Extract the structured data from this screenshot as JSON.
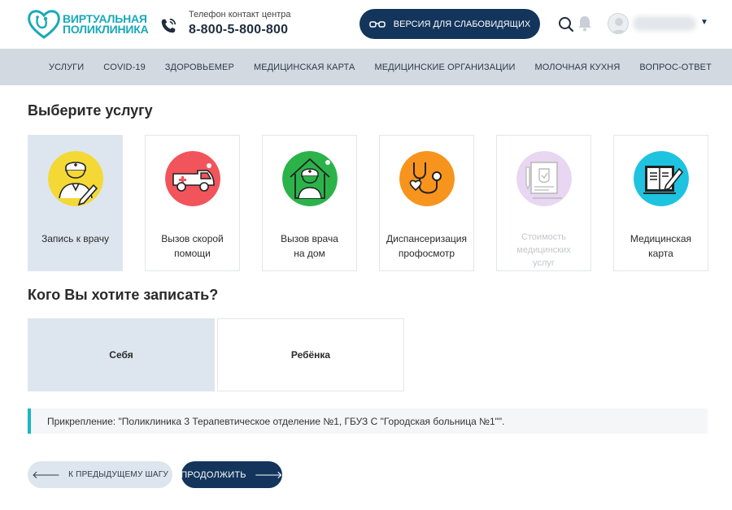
{
  "header": {
    "logo_line1": "ВИРТУАЛЬНАЯ",
    "logo_line2": "ПОЛИКЛИНИКА",
    "phone_caption": "Телефон контакт центра",
    "phone_number": "8-800-5-800-800",
    "low_vision_label": "ВЕРСИЯ ДЛЯ СЛАБОВИДЯЩИХ",
    "brand_color": "#1aa9b8",
    "dark_color": "#13355c"
  },
  "nav": {
    "items": [
      "УСЛУГИ",
      "COVID-19",
      "ЗДОРОВЬЕМЕР",
      "МЕДИЦИНСКАЯ КАРТА",
      "МЕДИЦИНСКИЕ ОРГАНИЗАЦИИ",
      "МОЛОЧНАЯ КУХНЯ",
      "ВОПРОС-ОТВЕТ"
    ]
  },
  "service_section": {
    "title": "Выберите услугу",
    "cards": [
      {
        "line1": "Запись к врачу",
        "line2": "",
        "line3": "",
        "icon": "doctor-writing-icon",
        "color": "#f4d836",
        "state": "active"
      },
      {
        "line1": "Вызов скорой",
        "line2": "помощи",
        "line3": "",
        "icon": "ambulance-icon",
        "color": "#f2545b",
        "state": "normal"
      },
      {
        "line1": "Вызов врача",
        "line2": "на дом",
        "line3": "",
        "icon": "home-doctor-icon",
        "color": "#2bb34a",
        "state": "normal"
      },
      {
        "line1": "Диспансеризация",
        "line2": "профосмотр",
        "line3": "",
        "icon": "stethoscope-icon",
        "color": "#f7941d",
        "state": "normal"
      },
      {
        "line1": "Стоимость",
        "line2": "медицинских",
        "line3": "услуг",
        "icon": "price-document-icon",
        "color": "#b57bd6",
        "state": "disabled"
      },
      {
        "line1": "Медицинская",
        "line2": "карта",
        "line3": "",
        "icon": "medical-book-icon",
        "color": "#1ec3e0",
        "state": "normal"
      }
    ]
  },
  "whom_section": {
    "title": "Кого Вы хотите записать?",
    "self_label": "Себя",
    "child_label": "Ребёнка"
  },
  "attachment_text": "Прикрепление: \"Поликлиника 3 Терапевтическое отделение №1, ГБУЗ С \"Городская больница №1\"\".",
  "buttons": {
    "back_label": "К ПРЕДЫДУЩЕМУ ШАГУ",
    "next_label": "ПРОДОЛЖИТЬ"
  }
}
